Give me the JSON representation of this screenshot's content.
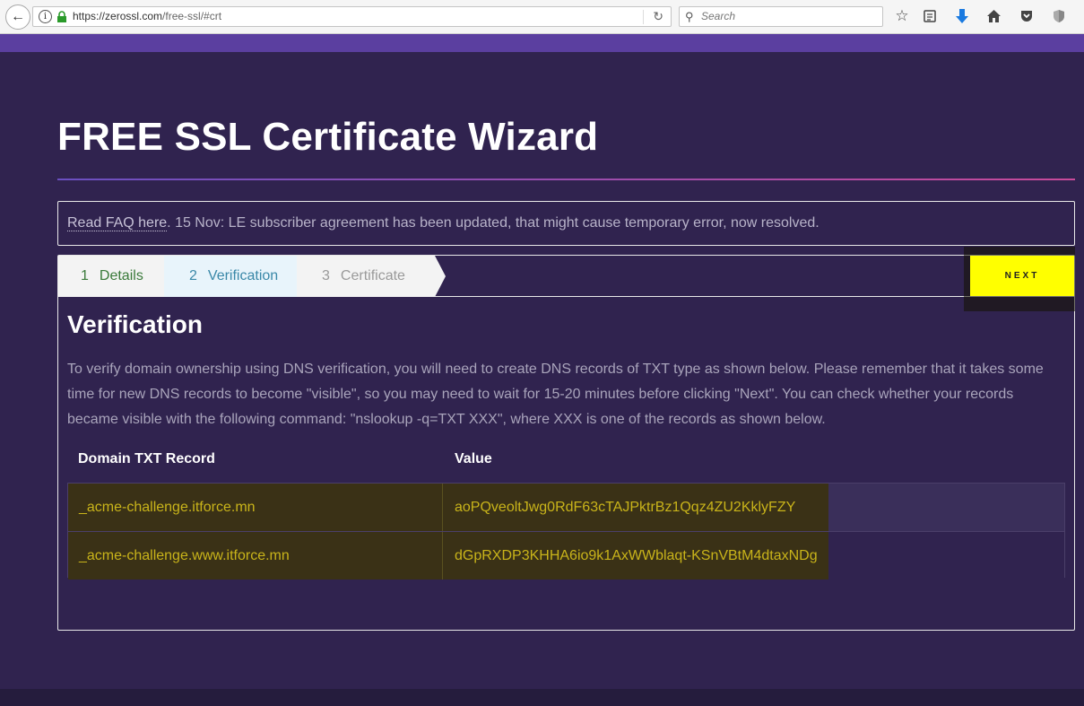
{
  "browser": {
    "url_host": "https://zerossl.com",
    "url_path": "/free-ssl/#crt",
    "search_placeholder": "Search"
  },
  "page": {
    "title": "FREE SSL Certificate Wizard",
    "notice_link": "Read FAQ here",
    "notice_text": ". 15 Nov: LE subscriber agreement has been updated, that might cause temporary error, now resolved."
  },
  "wizard": {
    "steps": [
      {
        "number": "1",
        "label": "Details"
      },
      {
        "number": "2",
        "label": "Verification"
      },
      {
        "number": "3",
        "label": "Certificate"
      }
    ],
    "next_label": "NEXT",
    "section_title": "Verification",
    "description": "To verify domain ownership using DNS verification, you will need to create DNS records of TXT type as shown below. Please remember that it takes some time for new DNS records to become \"visible\", so you may need to wait for 15-20 minutes before clicking \"Next\". You can check whether your records became visible with the following command: \"nslookup -q=TXT XXX\", where XXX is one of the records as shown below."
  },
  "table": {
    "headers": [
      "Domain TXT Record",
      "Value"
    ],
    "rows": [
      {
        "domain": "_acme-challenge.itforce.mn",
        "value": "aoPQveoltJwg0RdF63cTAJPktrBz1Qqz4ZU2KklyFZY"
      },
      {
        "domain": "_acme-challenge.www.itforce.mn",
        "value": "dGpRXDP3KHHA6io9k1AxWWblaqt-KSnVBtM4dtaxNDg"
      }
    ]
  }
}
